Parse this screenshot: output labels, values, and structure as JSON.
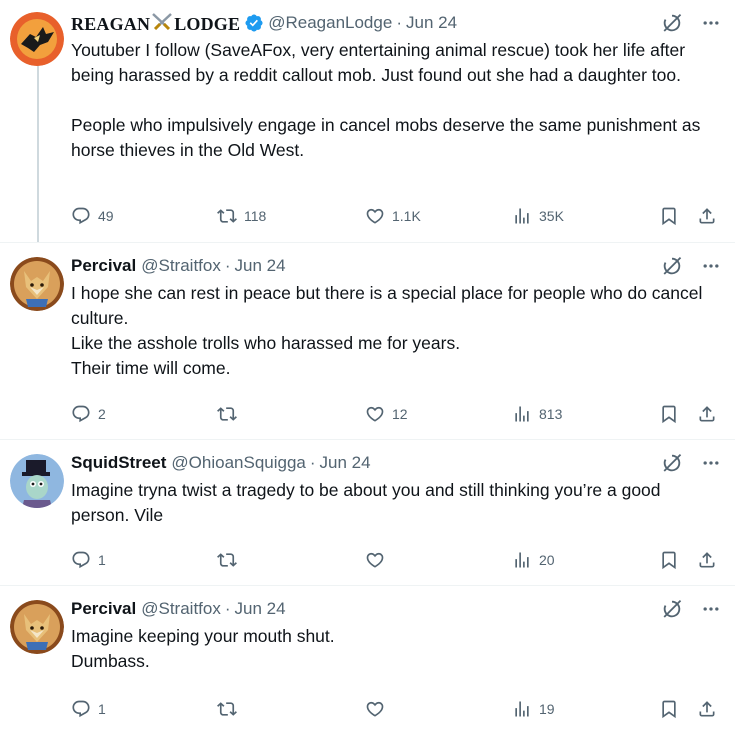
{
  "tweets": [
    {
      "display_name": "REAGAN",
      "display_name_suffix": "LODGE",
      "name_emoji": "crossed-swords",
      "verified": true,
      "handle": "@ReaganLodge",
      "dot": "·",
      "date": "Jun 24",
      "text": "Youtuber I follow (SaveAFox, very entertaining animal rescue) took her life after being harassed by a reddit callout mob. Just found out she had a daughter too.\n\nPeople who impulsively engage in cancel mobs deserve the same punishment as horse thieves in the Old West.",
      "replies": "49",
      "reposts": "118",
      "likes": "1.1K",
      "views": "35K"
    },
    {
      "display_name": "Percival",
      "handle": "@Straitfox",
      "dot": "·",
      "date": "Jun 24",
      "text": "I hope she can rest in peace but there is a special place for people who do cancel culture.\nLike the asshole trolls who harassed me for years.\nTheir time will come.",
      "replies": "2",
      "reposts": "",
      "likes": "12",
      "views": "813"
    },
    {
      "display_name": "SquidStreet",
      "handle": "@OhioanSquigga",
      "dot": "·",
      "date": "Jun 24",
      "text": "Imagine tryna twist a tragedy to be about you and still thinking you’re a good person. Vile",
      "replies": "1",
      "reposts": "",
      "likes": "",
      "views": "20"
    },
    {
      "display_name": "Percival",
      "handle": "@Straitfox",
      "dot": "·",
      "date": "Jun 24",
      "text": "Imagine keeping your mouth shut.\nDumbass.",
      "replies": "1",
      "reposts": "",
      "likes": "",
      "views": "19"
    }
  ],
  "icons": {
    "reply": "reply-icon",
    "repost": "repost-icon",
    "like": "like-icon",
    "views": "views-icon",
    "bookmark": "bookmark-icon",
    "share": "share-icon",
    "grok": "grok-icon",
    "more": "more-icon"
  },
  "colors": {
    "text": "#0f1419",
    "secondary": "#536471",
    "verified": "#1d9bf0",
    "divider": "#eff3f4"
  }
}
